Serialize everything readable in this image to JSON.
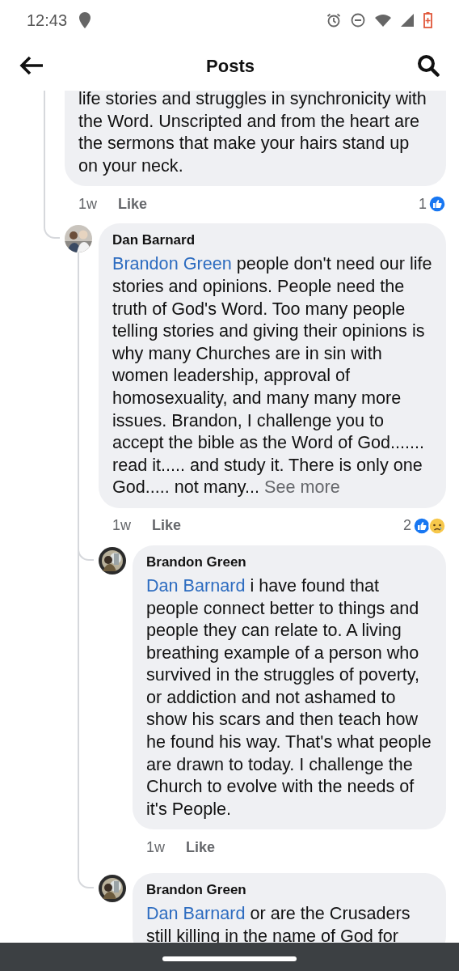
{
  "status_bar": {
    "time": "12:43"
  },
  "header": {
    "title": "Posts"
  },
  "comments": [
    {
      "text": "life stories and struggles in synchronicity with the Word. Unscripted and from the heart are the sermons that make your hairs stand up on your neck.",
      "time": "1w",
      "like": "Like",
      "reaction_count": "1",
      "reactions": [
        {
          "kind": "like"
        }
      ],
      "children": [
        {
          "author": "Dan Barnard",
          "mention": "Brandon Green",
          "text": "people don't need our life stories and opinions. People need the truth of God's Word. Too many people telling stories and giving their opinions is why many Churches are in sin with women leadership, approval of homosexuality, and many many more issues. Brandon, I challenge you to accept the bible as the Word of God....... read it..... and study it. There is only one God..... not many...",
          "see_more": "See more",
          "time": "1w",
          "like": "Like",
          "reaction_count": "2",
          "reactions": [
            {
              "kind": "like"
            },
            {
              "kind": "sad"
            }
          ],
          "children": [
            {
              "author": "Brandon Green",
              "mention": "Dan Barnard",
              "text": "i have found that people connect better to things and people they can relate to. A living breathing example of a person who survived in the struggles of poverty, or addiction and not ashamed to show his scars and then teach how he found his way. That's what people are drawn to today. I challenge the Church to evolve with the needs of it's People.",
              "time": "1w",
              "like": "Like"
            },
            {
              "author": "Brandon Green",
              "mention": "Dan Barnard",
              "text": "or are the Crusaders still killing in the name of God for"
            }
          ]
        }
      ]
    }
  ]
}
